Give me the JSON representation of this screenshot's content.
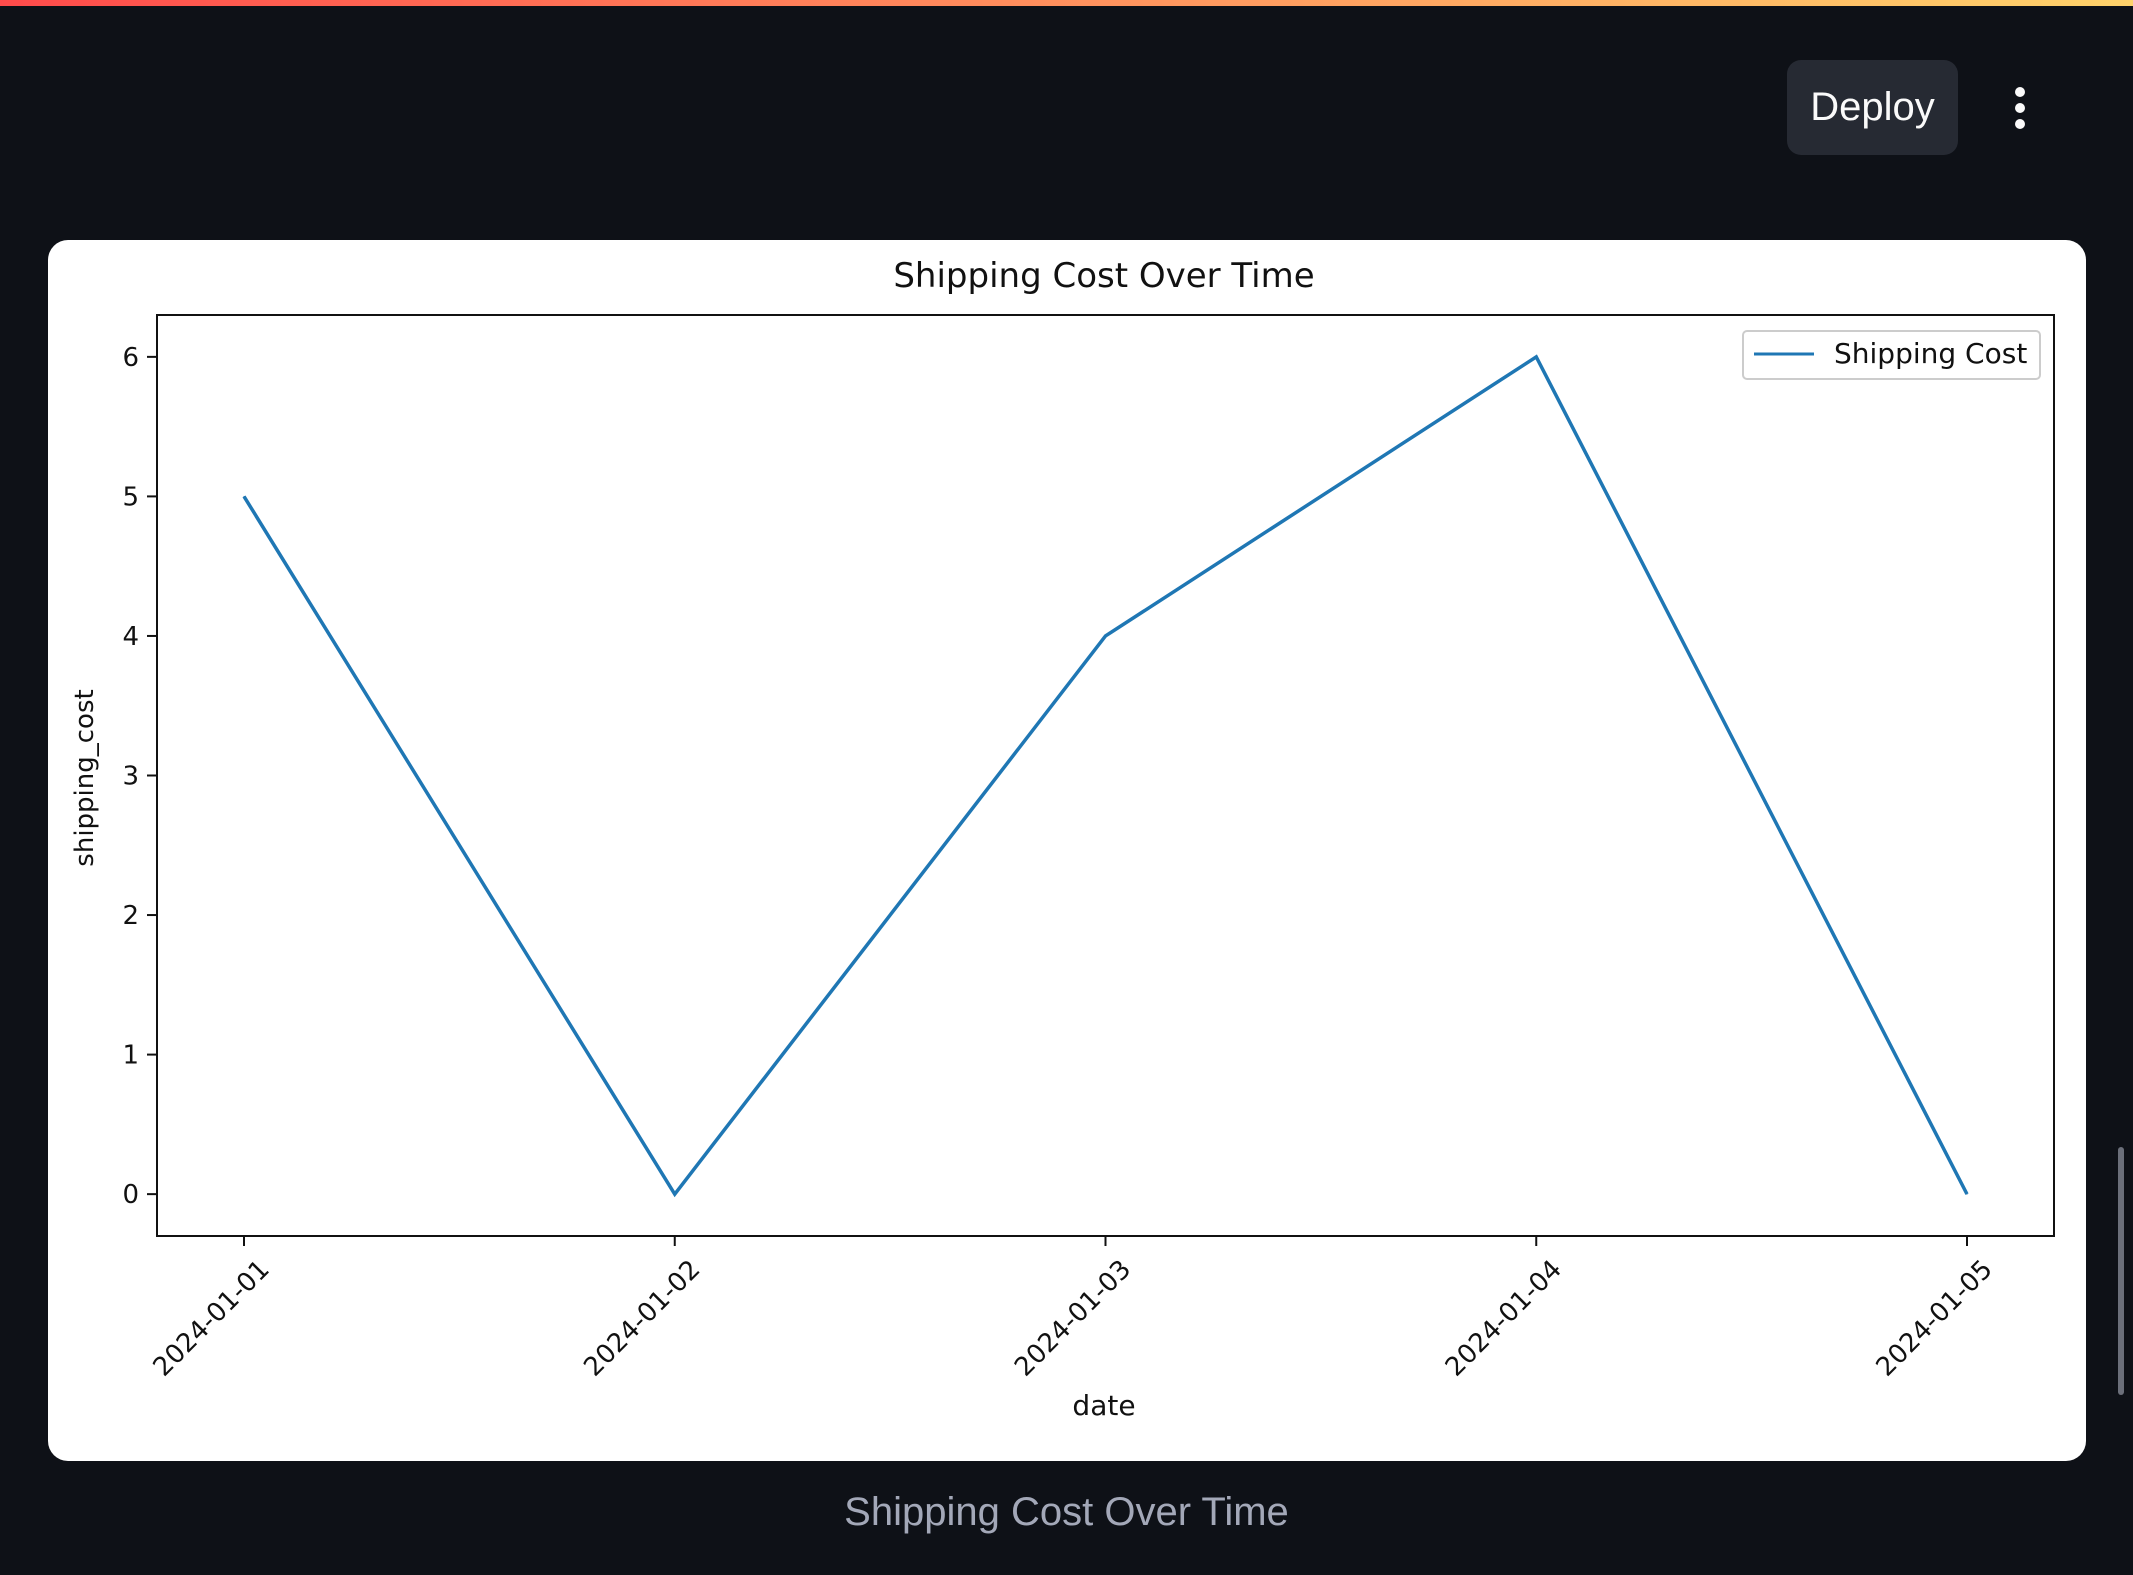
{
  "header": {
    "deploy_label": "Deploy",
    "menu_icon": "vertical-ellipsis-icon"
  },
  "chart_data": {
    "type": "line",
    "title": "Shipping Cost Over Time",
    "xlabel": "date",
    "ylabel": "shipping_cost",
    "x": [
      "2024-01-01",
      "2024-01-02",
      "2024-01-03",
      "2024-01-04",
      "2024-01-05"
    ],
    "series": [
      {
        "name": "Shipping Cost",
        "values": [
          5,
          0,
          4,
          6,
          0
        ],
        "color": "#1f77b4"
      }
    ],
    "yticks": [
      "0",
      "1",
      "2",
      "3",
      "4",
      "5",
      "6"
    ],
    "ylim": [
      -0.3,
      6.3
    ],
    "legend": "upper-right",
    "grid": false
  },
  "caption": "Shipping Cost Over Time"
}
